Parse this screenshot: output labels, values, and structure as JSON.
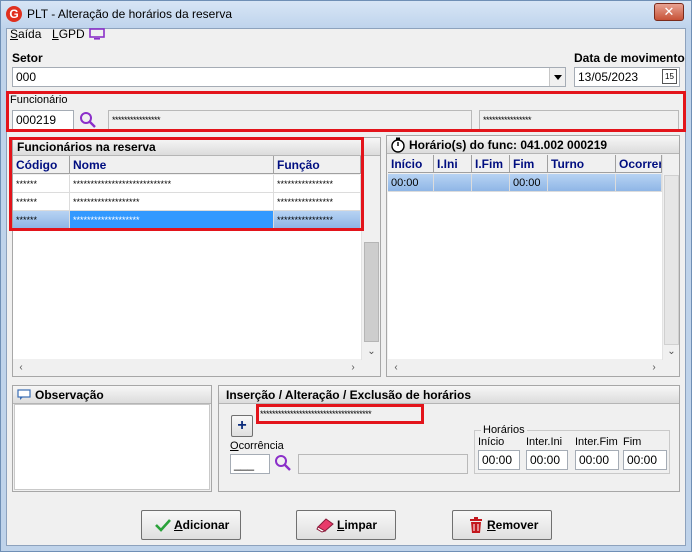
{
  "window": {
    "logo_letter": "G",
    "title": "PLT - Alteração de horários da reserva",
    "close_symbol": "✕"
  },
  "menu": {
    "items": [
      {
        "first": "S",
        "rest": "aída"
      },
      {
        "first": "L",
        "rest": "GPD"
      }
    ],
    "monitor_icon": "monitor-icon"
  },
  "setor": {
    "label": "Setor",
    "value": "000"
  },
  "data_movimento": {
    "label": "Data de movimento",
    "value": "13/05/2023",
    "calendar_glyph": "15"
  },
  "funcionario": {
    "label": "Funcionário",
    "code": "000219",
    "name_mask": "****************",
    "extra_mask": "****************"
  },
  "funcionarios_reserva": {
    "title": "Funcionários na reserva",
    "columns": [
      "Código",
      "Nome",
      "Função"
    ],
    "rows": [
      {
        "codigo": "******",
        "nome": "****************************",
        "funcao": "****************"
      },
      {
        "codigo": "******",
        "nome": "*******************",
        "funcao": "****************"
      },
      {
        "codigo": "******",
        "nome": "*******************",
        "funcao": "****************",
        "selected": true
      }
    ]
  },
  "horarios": {
    "title": "Horário(s) do func: 041.002  000219",
    "columns": [
      "Início",
      "I.Ini",
      "I.Fim",
      "Fim",
      "Turno",
      "Ocorrer"
    ],
    "rows": [
      {
        "inicio": "00:00",
        "iini": "",
        "ifim": "",
        "fim": "00:00",
        "turno": "",
        "ocorrer": ""
      }
    ]
  },
  "observacao": {
    "title": "Observação"
  },
  "insercao": {
    "title": "Inserção / Alteração / Exclusão de horários",
    "add_symbol": "+",
    "mask": "*************************************",
    "ocorrencia_first": "O",
    "ocorrencia_rest": "corrência",
    "ocorrencia_value": "___",
    "horarios_group": "Horários",
    "fields": [
      {
        "label": "Início",
        "value": "00:00"
      },
      {
        "label": "Inter.Ini",
        "value": "00:00"
      },
      {
        "label": "Inter.Fim",
        "value": "00:00"
      },
      {
        "label": "Fim",
        "value": "00:00"
      }
    ]
  },
  "buttons": {
    "adicionar": {
      "first": "A",
      "rest": "dicionar"
    },
    "limpar": {
      "first": "L",
      "rest": "impar"
    },
    "remover": {
      "first": "R",
      "rest": "emover"
    }
  },
  "colors": {
    "accent_red": "#e3141b",
    "selection_blue": "#3399ff",
    "header_text": "#000e80",
    "search_icon": "#8b2fc9"
  }
}
